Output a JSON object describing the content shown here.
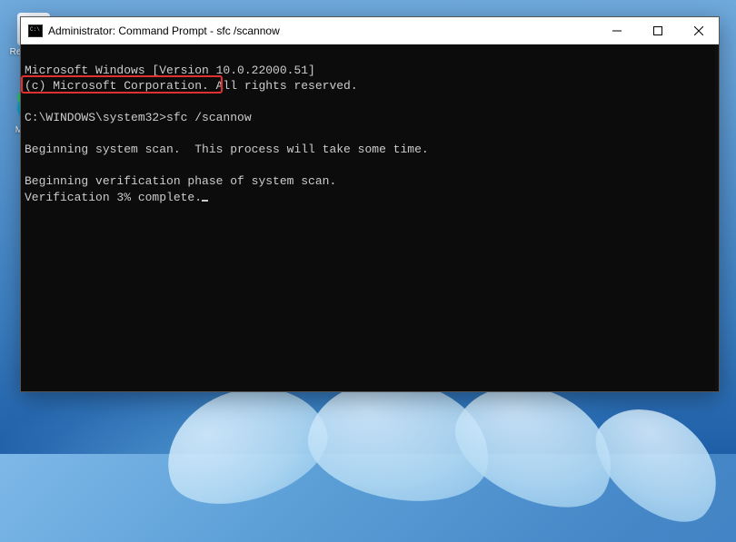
{
  "desktop": {
    "recycle_label": "Recycle Bin",
    "edge_label": "Microsoft Edge"
  },
  "window": {
    "title": "Administrator: Command Prompt - sfc  /scannow",
    "controls": {
      "minimize": "Minimize",
      "maximize": "Maximize",
      "close": "Close"
    }
  },
  "terminal": {
    "line1": "Microsoft Windows [Version 10.0.22000.51]",
    "line2": "(c) Microsoft Corporation. All rights reserved.",
    "blank1": "",
    "prompt_line": "C:\\WINDOWS\\system32>sfc /scannow",
    "blank2": "",
    "scan_begin": "Beginning system scan.  This process will take some time.",
    "blank3": "",
    "verify_phase": "Beginning verification phase of system scan.",
    "verify_progress": "Verification 3% complete."
  }
}
